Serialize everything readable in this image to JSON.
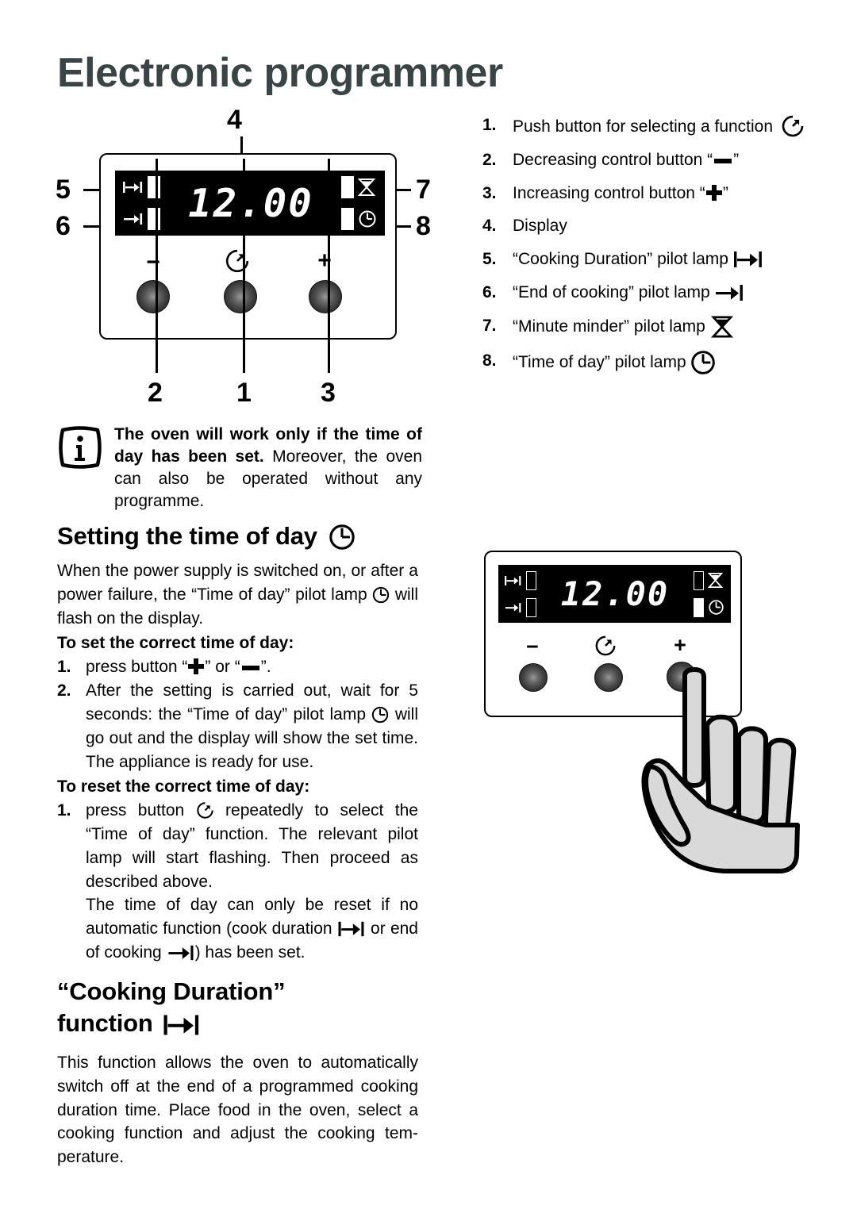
{
  "page": {
    "title": "Electronic programmer"
  },
  "diagram": {
    "display_time": "12.00",
    "callouts": [
      "1",
      "2",
      "3",
      "4",
      "5",
      "6",
      "7",
      "8"
    ],
    "minus_label": "−",
    "plus_label": "+"
  },
  "legend": {
    "items": [
      {
        "num": "1.",
        "text": "Push button for selecting a function",
        "icon": "function-clock-icon"
      },
      {
        "num": "2.",
        "text": "Decreasing control button “",
        "text_after": "”",
        "icon": "minus-icon"
      },
      {
        "num": "3.",
        "text": "Increasing control button “",
        "text_after": "”",
        "icon": "plus-icon"
      },
      {
        "num": "4.",
        "text": "Display",
        "icon": ""
      },
      {
        "num": "5.",
        "text": "“Cooking Duration” pilot lamp",
        "icon": "cooking-duration-icon"
      },
      {
        "num": "6.",
        "text": "“End of cooking” pilot lamp",
        "icon": "end-of-cooking-icon"
      },
      {
        "num": "7.",
        "text": "“Minute minder”  pilot lamp",
        "icon": "hourglass-icon"
      },
      {
        "num": "8.",
        "text": "“Time of day” pilot lamp",
        "icon": "clock-icon"
      }
    ]
  },
  "note": {
    "bold": "The oven will work only if the time of day has been set.",
    "rest": " Moreover, the oven can also be operated without any programme."
  },
  "section_time": {
    "heading": "Setting the time of day",
    "intro_1": "When the power supply is switched on, or after a power failure, the “Time of day” pilot lamp ",
    "intro_2": " will flash on the display.",
    "set_heading": "To set the correct time of day:",
    "step1_num": "1.",
    "step1_a": "press button “",
    "step1_b": "” or “",
    "step1_c": "”.",
    "step2_num": "2.",
    "step2_a": "After the setting is carried out, wait for 5 seconds: the “Time of day” pilot lamp ",
    "step2_b": " will go out and the display will show the set time. The appliance is ready for use.",
    "reset_heading": "To reset the correct time of day:",
    "reset1_num": "1.",
    "reset1_a": "press button ",
    "reset1_b": " repeatedly to select the “Time of day” function. The relevant pilot lamp will start flashing. Then proceed as described above.",
    "reset2_a": "The time of day can only be reset  if no automatic function (cook duration ",
    "reset2_b": " or end of cooking ",
    "reset2_c": ") has been set."
  },
  "section_duration": {
    "heading_line1": "“Cooking Duration”",
    "heading_line2": "function",
    "body": "This function allows the oven to automatically switch off at the end of a programmed cooking duration time. Place  food in the oven, select a cooking function and adjust the cooking tem-perature."
  },
  "colors": {
    "title": "#3a4446",
    "text": "#000000",
    "display_bg": "#000000",
    "display_fg": "#ffffff",
    "hand_fill": "#d9d9d9"
  }
}
